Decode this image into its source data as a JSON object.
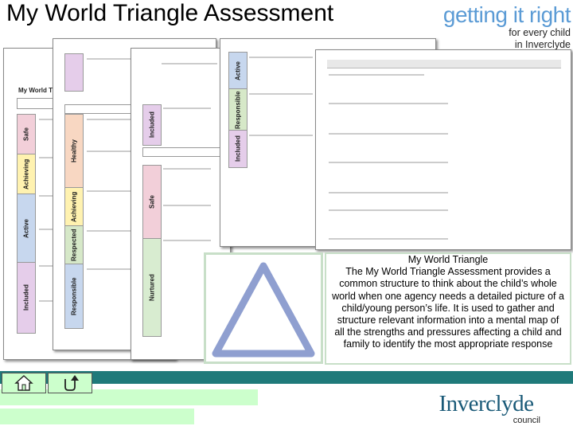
{
  "slide": {
    "title": "My World Triangle Assessment"
  },
  "header_logo": {
    "line1": "getting it right",
    "line2": "for every child",
    "line3": "in Inverclyde"
  },
  "thumbnails": {
    "page1": {
      "heading": "My World Tri",
      "bands": [
        "Safe",
        "Achieving",
        "Active",
        "Included"
      ]
    },
    "page2": {
      "bands": [
        "Healthy",
        "Achieving",
        "Respected",
        "Responsible"
      ]
    },
    "page3": {
      "bands": [
        "Included",
        "Safe",
        "Nurtured"
      ]
    },
    "page4": {
      "bands": [
        "Active",
        "Responsible",
        "Included"
      ]
    }
  },
  "description": {
    "title": "My World Triangle",
    "body": "The My World Triangle Assessment provides a common structure to think about the child’s whole world when one agency needs a detailed picture of a child/young person’s life. It is used to gather and structure relevant information into a mental map of all the strengths and pressures affecting a child and family to identify the most appropriate response"
  },
  "nav": {
    "home_icon": "home-icon",
    "return_icon": "return-arrow-icon"
  },
  "footer_logo": {
    "name": "Inverclyde",
    "sub": "council"
  },
  "colors": {
    "teal_bar": "#1f7a7a",
    "light_green": "#ccffcc",
    "triangle": "#8f9fd0",
    "band_safe": "#f2cfd9",
    "band_achieving": "#fff2b0",
    "band_active": "#c7d7ee",
    "band_included": "#e5cdea",
    "band_healthy": "#f8d7c2",
    "band_respected": "#d6e8c8",
    "band_nurtured": "#d8ecd0"
  }
}
